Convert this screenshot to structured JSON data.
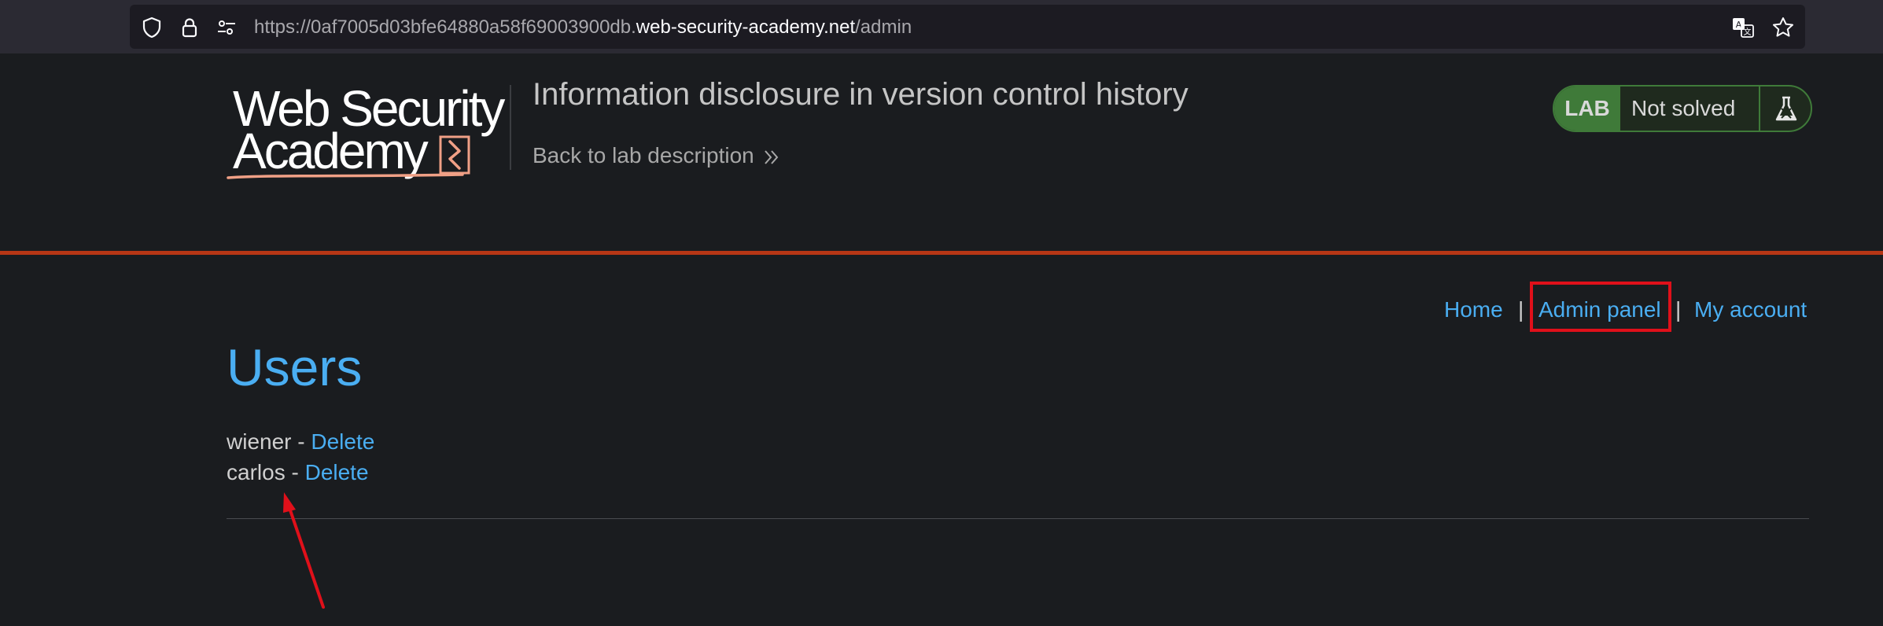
{
  "browser": {
    "url_prefix": "https://0af7005d03bfe64880a58f69003900db.",
    "url_host": "web-security-academy.net",
    "url_path": "/admin",
    "icons": [
      "shield-icon",
      "lock-icon",
      "permissions-icon",
      "translate-icon",
      "bookmark-star-icon"
    ]
  },
  "lab_header": {
    "logo_line1": "Web Security",
    "logo_line2": "Academy",
    "title": "Information disclosure in version control history",
    "back_link": "Back to lab description",
    "status_badge": "LAB",
    "status_text": "Not solved",
    "accent_color": "#b63615",
    "status_color": "#3f7a39"
  },
  "nav": {
    "home": "Home",
    "separator": "|",
    "admin_panel": "Admin panel",
    "my_account": "My account"
  },
  "main": {
    "heading": "Users",
    "users": [
      {
        "name": "wiener",
        "separator": " - ",
        "action": "Delete"
      },
      {
        "name": "carlos",
        "separator": " - ",
        "action": "Delete"
      }
    ]
  },
  "annotations": {
    "highlight_color": "#e0101a"
  }
}
